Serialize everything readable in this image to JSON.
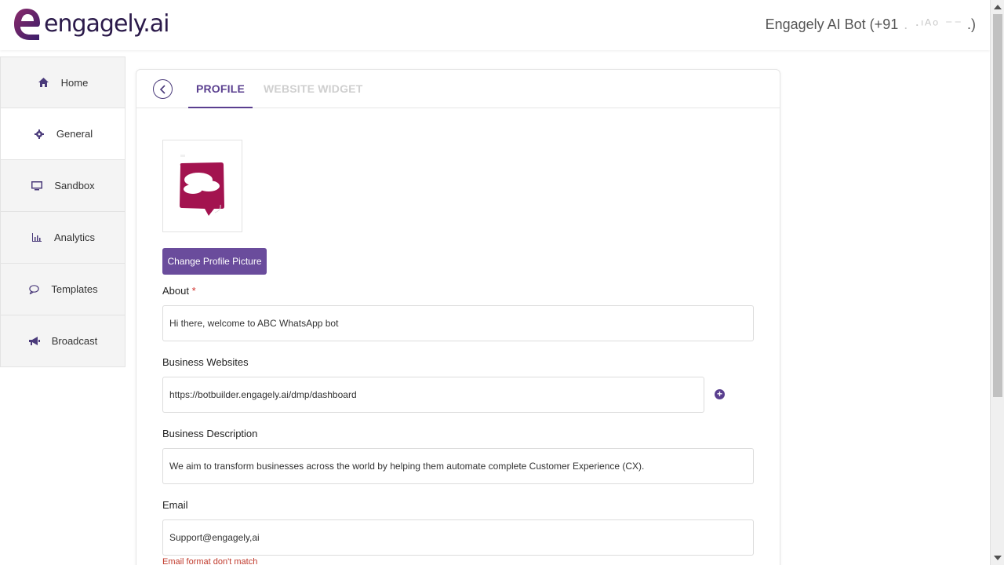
{
  "header": {
    "logo_text": "engagely.ai",
    "bot_name": "Engagely AI Bot (+91",
    "bot_name_redacted": " .  ·ᶦᴬᵒ   ⁻⁻",
    "bot_name_close": " .)"
  },
  "sidebar": {
    "items": [
      {
        "label": "Home",
        "icon": "home-icon"
      },
      {
        "label": "General",
        "icon": "gear-icon"
      },
      {
        "label": "Sandbox",
        "icon": "monitor-icon"
      },
      {
        "label": "Analytics",
        "icon": "chart-icon"
      },
      {
        "label": "Templates",
        "icon": "chat-icon"
      },
      {
        "label": "Broadcast",
        "icon": "megaphone-icon"
      }
    ],
    "active": "General"
  },
  "tabs": {
    "profile": "PROFILE",
    "website_widget": "WEBSITE WIDGET"
  },
  "profile": {
    "change_picture_label": "Change Profile Picture",
    "about_label": "About",
    "about_required": "*",
    "about_value": "Hi there, welcome to ABC WhatsApp bot",
    "websites_label": "Business Websites",
    "website_value": "https://botbuilder.engagely.ai/dmp/dashboard",
    "description_label": "Business Description",
    "description_value": "We aim to transform businesses across the world by helping them automate complete Customer Experience (CX).",
    "email_label": "Email",
    "email_value": "Support@engagely,ai",
    "email_error": "Email format don't match"
  },
  "colors": {
    "accent": "#6a4c9c",
    "brand_dark": "#2b1a4a",
    "error": "#c0392b",
    "avatar_bg": "#a3134f"
  }
}
